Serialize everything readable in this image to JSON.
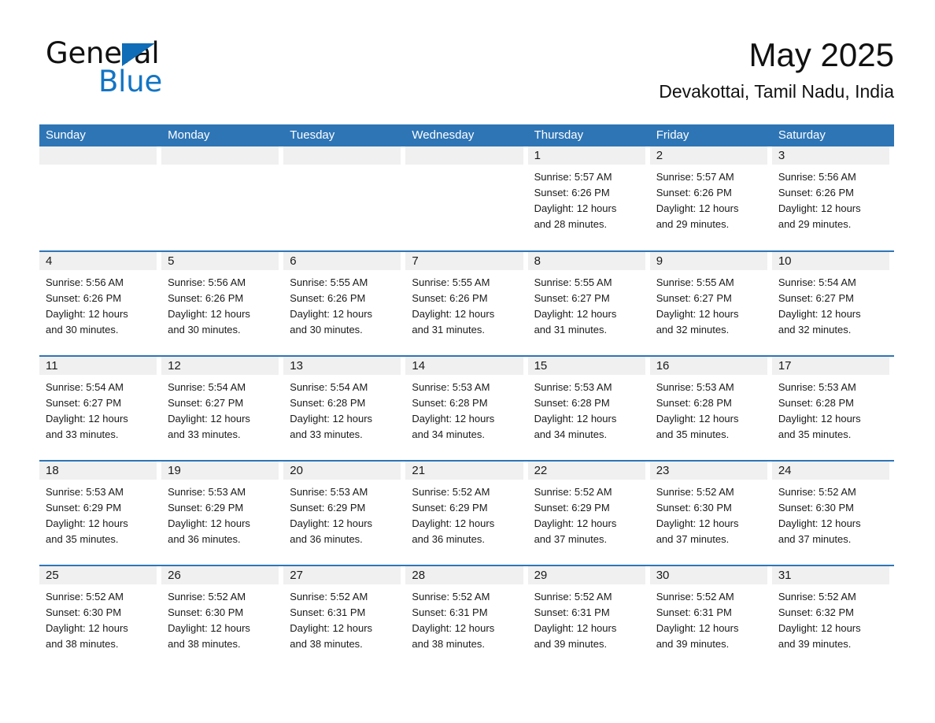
{
  "brand": {
    "name_part1": "General",
    "name_part2": "Blue",
    "accent_color": "#1275c4",
    "triangle_color": "#0f6cb6"
  },
  "header": {
    "month_title": "May 2025",
    "location": "Devakottai, Tamil Nadu, India"
  },
  "calendar": {
    "header_color": "#2e75b6",
    "day_band_color": "#f0f0f0",
    "weekdays": [
      "Sunday",
      "Monday",
      "Tuesday",
      "Wednesday",
      "Thursday",
      "Friday",
      "Saturday"
    ],
    "weeks": [
      [
        {
          "day": "",
          "empty": true,
          "sunrise": "",
          "sunset": "",
          "daylight_line1": "",
          "daylight_line2": ""
        },
        {
          "day": "",
          "empty": true,
          "sunrise": "",
          "sunset": "",
          "daylight_line1": "",
          "daylight_line2": ""
        },
        {
          "day": "",
          "empty": true,
          "sunrise": "",
          "sunset": "",
          "daylight_line1": "",
          "daylight_line2": ""
        },
        {
          "day": "",
          "empty": true,
          "sunrise": "",
          "sunset": "",
          "daylight_line1": "",
          "daylight_line2": ""
        },
        {
          "day": "1",
          "sunrise": "Sunrise: 5:57 AM",
          "sunset": "Sunset: 6:26 PM",
          "daylight_line1": "Daylight: 12 hours",
          "daylight_line2": "and 28 minutes."
        },
        {
          "day": "2",
          "sunrise": "Sunrise: 5:57 AM",
          "sunset": "Sunset: 6:26 PM",
          "daylight_line1": "Daylight: 12 hours",
          "daylight_line2": "and 29 minutes."
        },
        {
          "day": "3",
          "sunrise": "Sunrise: 5:56 AM",
          "sunset": "Sunset: 6:26 PM",
          "daylight_line1": "Daylight: 12 hours",
          "daylight_line2": "and 29 minutes."
        }
      ],
      [
        {
          "day": "4",
          "sunrise": "Sunrise: 5:56 AM",
          "sunset": "Sunset: 6:26 PM",
          "daylight_line1": "Daylight: 12 hours",
          "daylight_line2": "and 30 minutes."
        },
        {
          "day": "5",
          "sunrise": "Sunrise: 5:56 AM",
          "sunset": "Sunset: 6:26 PM",
          "daylight_line1": "Daylight: 12 hours",
          "daylight_line2": "and 30 minutes."
        },
        {
          "day": "6",
          "sunrise": "Sunrise: 5:55 AM",
          "sunset": "Sunset: 6:26 PM",
          "daylight_line1": "Daylight: 12 hours",
          "daylight_line2": "and 30 minutes."
        },
        {
          "day": "7",
          "sunrise": "Sunrise: 5:55 AM",
          "sunset": "Sunset: 6:26 PM",
          "daylight_line1": "Daylight: 12 hours",
          "daylight_line2": "and 31 minutes."
        },
        {
          "day": "8",
          "sunrise": "Sunrise: 5:55 AM",
          "sunset": "Sunset: 6:27 PM",
          "daylight_line1": "Daylight: 12 hours",
          "daylight_line2": "and 31 minutes."
        },
        {
          "day": "9",
          "sunrise": "Sunrise: 5:55 AM",
          "sunset": "Sunset: 6:27 PM",
          "daylight_line1": "Daylight: 12 hours",
          "daylight_line2": "and 32 minutes."
        },
        {
          "day": "10",
          "sunrise": "Sunrise: 5:54 AM",
          "sunset": "Sunset: 6:27 PM",
          "daylight_line1": "Daylight: 12 hours",
          "daylight_line2": "and 32 minutes."
        }
      ],
      [
        {
          "day": "11",
          "sunrise": "Sunrise: 5:54 AM",
          "sunset": "Sunset: 6:27 PM",
          "daylight_line1": "Daylight: 12 hours",
          "daylight_line2": "and 33 minutes."
        },
        {
          "day": "12",
          "sunrise": "Sunrise: 5:54 AM",
          "sunset": "Sunset: 6:27 PM",
          "daylight_line1": "Daylight: 12 hours",
          "daylight_line2": "and 33 minutes."
        },
        {
          "day": "13",
          "sunrise": "Sunrise: 5:54 AM",
          "sunset": "Sunset: 6:28 PM",
          "daylight_line1": "Daylight: 12 hours",
          "daylight_line2": "and 33 minutes."
        },
        {
          "day": "14",
          "sunrise": "Sunrise: 5:53 AM",
          "sunset": "Sunset: 6:28 PM",
          "daylight_line1": "Daylight: 12 hours",
          "daylight_line2": "and 34 minutes."
        },
        {
          "day": "15",
          "sunrise": "Sunrise: 5:53 AM",
          "sunset": "Sunset: 6:28 PM",
          "daylight_line1": "Daylight: 12 hours",
          "daylight_line2": "and 34 minutes."
        },
        {
          "day": "16",
          "sunrise": "Sunrise: 5:53 AM",
          "sunset": "Sunset: 6:28 PM",
          "daylight_line1": "Daylight: 12 hours",
          "daylight_line2": "and 35 minutes."
        },
        {
          "day": "17",
          "sunrise": "Sunrise: 5:53 AM",
          "sunset": "Sunset: 6:28 PM",
          "daylight_line1": "Daylight: 12 hours",
          "daylight_line2": "and 35 minutes."
        }
      ],
      [
        {
          "day": "18",
          "sunrise": "Sunrise: 5:53 AM",
          "sunset": "Sunset: 6:29 PM",
          "daylight_line1": "Daylight: 12 hours",
          "daylight_line2": "and 35 minutes."
        },
        {
          "day": "19",
          "sunrise": "Sunrise: 5:53 AM",
          "sunset": "Sunset: 6:29 PM",
          "daylight_line1": "Daylight: 12 hours",
          "daylight_line2": "and 36 minutes."
        },
        {
          "day": "20",
          "sunrise": "Sunrise: 5:53 AM",
          "sunset": "Sunset: 6:29 PM",
          "daylight_line1": "Daylight: 12 hours",
          "daylight_line2": "and 36 minutes."
        },
        {
          "day": "21",
          "sunrise": "Sunrise: 5:52 AM",
          "sunset": "Sunset: 6:29 PM",
          "daylight_line1": "Daylight: 12 hours",
          "daylight_line2": "and 36 minutes."
        },
        {
          "day": "22",
          "sunrise": "Sunrise: 5:52 AM",
          "sunset": "Sunset: 6:29 PM",
          "daylight_line1": "Daylight: 12 hours",
          "daylight_line2": "and 37 minutes."
        },
        {
          "day": "23",
          "sunrise": "Sunrise: 5:52 AM",
          "sunset": "Sunset: 6:30 PM",
          "daylight_line1": "Daylight: 12 hours",
          "daylight_line2": "and 37 minutes."
        },
        {
          "day": "24",
          "sunrise": "Sunrise: 5:52 AM",
          "sunset": "Sunset: 6:30 PM",
          "daylight_line1": "Daylight: 12 hours",
          "daylight_line2": "and 37 minutes."
        }
      ],
      [
        {
          "day": "25",
          "sunrise": "Sunrise: 5:52 AM",
          "sunset": "Sunset: 6:30 PM",
          "daylight_line1": "Daylight: 12 hours",
          "daylight_line2": "and 38 minutes."
        },
        {
          "day": "26",
          "sunrise": "Sunrise: 5:52 AM",
          "sunset": "Sunset: 6:30 PM",
          "daylight_line1": "Daylight: 12 hours",
          "daylight_line2": "and 38 minutes."
        },
        {
          "day": "27",
          "sunrise": "Sunrise: 5:52 AM",
          "sunset": "Sunset: 6:31 PM",
          "daylight_line1": "Daylight: 12 hours",
          "daylight_line2": "and 38 minutes."
        },
        {
          "day": "28",
          "sunrise": "Sunrise: 5:52 AM",
          "sunset": "Sunset: 6:31 PM",
          "daylight_line1": "Daylight: 12 hours",
          "daylight_line2": "and 38 minutes."
        },
        {
          "day": "29",
          "sunrise": "Sunrise: 5:52 AM",
          "sunset": "Sunset: 6:31 PM",
          "daylight_line1": "Daylight: 12 hours",
          "daylight_line2": "and 39 minutes."
        },
        {
          "day": "30",
          "sunrise": "Sunrise: 5:52 AM",
          "sunset": "Sunset: 6:31 PM",
          "daylight_line1": "Daylight: 12 hours",
          "daylight_line2": "and 39 minutes."
        },
        {
          "day": "31",
          "sunrise": "Sunrise: 5:52 AM",
          "sunset": "Sunset: 6:32 PM",
          "daylight_line1": "Daylight: 12 hours",
          "daylight_line2": "and 39 minutes."
        }
      ]
    ]
  }
}
